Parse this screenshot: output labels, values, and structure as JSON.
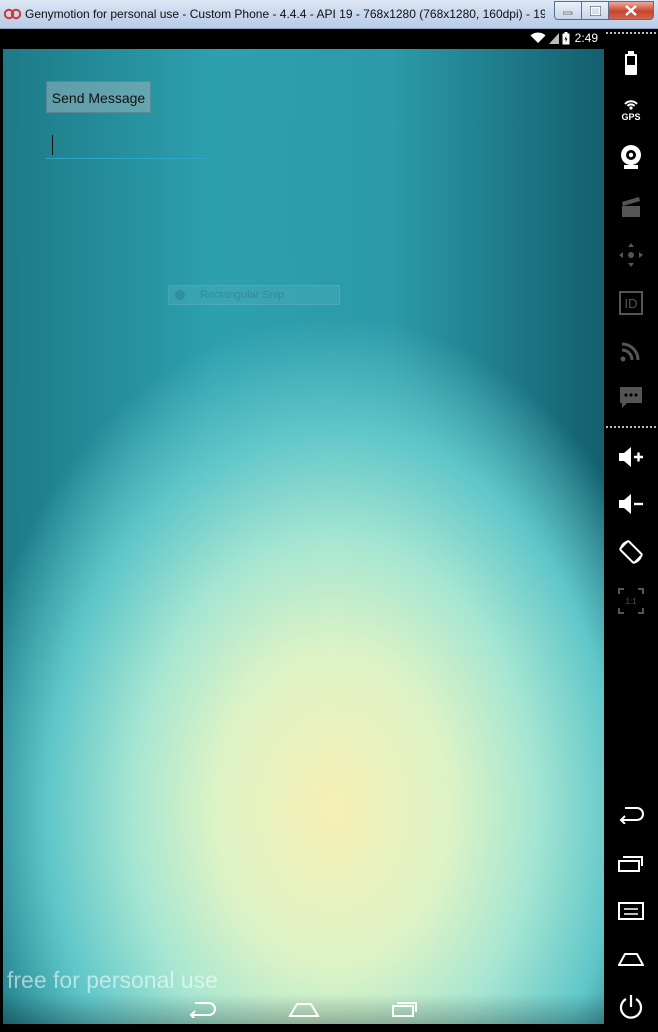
{
  "window": {
    "title": "Genymotion for personal use - Custom Phone - 4.4.4 - API 19 - 768x1280 (768x1280, 160dpi) - 19...",
    "minimize_icon": "minimize-icon",
    "maximize_icon": "maximize-icon",
    "close_icon": "close-icon"
  },
  "statusbar": {
    "time": "2:49",
    "icons": [
      "wifi-icon",
      "signal-icon",
      "battery-icon"
    ]
  },
  "app": {
    "send_button_label": "Send Message",
    "message_input_value": "",
    "message_input_placeholder": ""
  },
  "overlay": {
    "snip_label": "Rectangular Snip"
  },
  "watermark": "free for personal use",
  "navbar": {
    "buttons": [
      "back-icon",
      "home-icon",
      "recent-apps-icon"
    ]
  },
  "sidebar": {
    "tools": [
      {
        "name": "battery-icon",
        "label": ""
      },
      {
        "name": "gps-icon",
        "label": "GPS"
      },
      {
        "name": "webcam-icon",
        "label": ""
      },
      {
        "name": "media-clapper-icon",
        "label": ""
      },
      {
        "name": "dpad-icon",
        "label": ""
      },
      {
        "name": "device-id-icon",
        "label": "ID"
      },
      {
        "name": "network-feed-icon",
        "label": ""
      },
      {
        "name": "sms-icon",
        "label": ""
      },
      {
        "name": "volume-up-icon",
        "label": ""
      },
      {
        "name": "volume-down-icon",
        "label": ""
      },
      {
        "name": "rotate-icon",
        "label": ""
      },
      {
        "name": "scale-1-1-icon",
        "label": "1:1"
      },
      {
        "name": "back-icon",
        "label": ""
      },
      {
        "name": "recent-apps-icon",
        "label": ""
      },
      {
        "name": "menu-icon",
        "label": ""
      },
      {
        "name": "home-icon",
        "label": ""
      },
      {
        "name": "power-icon",
        "label": ""
      }
    ]
  },
  "colors": {
    "accent": "#2aa7cf",
    "background_teal": "#2da0ae",
    "background_yellow": "#f6f0b4"
  }
}
